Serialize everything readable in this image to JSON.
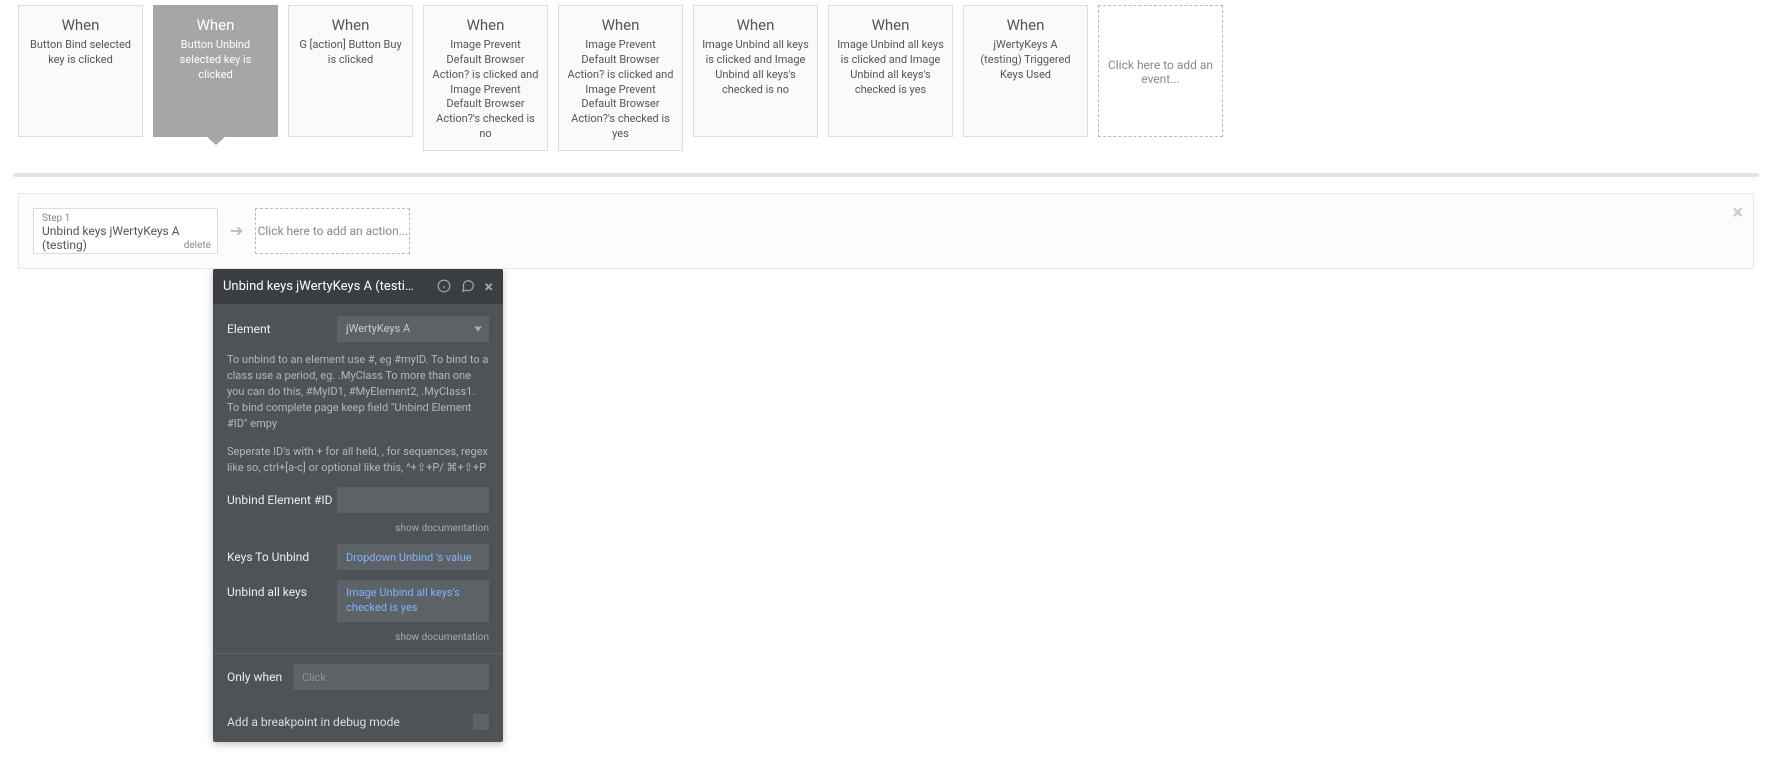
{
  "events": [
    {
      "title": "When",
      "body": "Button Bind selected key is clicked"
    },
    {
      "title": "When",
      "body": "Button Unbind selected key is clicked",
      "active": true
    },
    {
      "title": "When",
      "body": "G [action] Button Buy is clicked"
    },
    {
      "title": "When",
      "body": "Image Prevent Default Browser Action? is clicked and Image Prevent Default Browser Action?'s checked is no"
    },
    {
      "title": "When",
      "body": "Image Prevent Default Browser Action? is clicked and Image Prevent Default Browser Action?'s checked is yes"
    },
    {
      "title": "When",
      "body": "Image Unbind all keys is clicked and Image Unbind all keys's checked is no"
    },
    {
      "title": "When",
      "body": "Image Unbind all keys is clicked and Image Unbind all keys's checked is yes"
    },
    {
      "title": "When",
      "body": "jWertyKeys A (testing) Triggered Keys Used"
    }
  ],
  "add_event_label": "Click here to add an event...",
  "step": {
    "label": "Step 1",
    "title": "Unbind keys jWertyKeys A (testing)",
    "delete": "delete"
  },
  "add_step_label": "Click here to add an action...",
  "panel": {
    "header": "Unbind keys jWertyKeys A (testing)",
    "element_label": "Element",
    "element_value": "jWertyKeys A",
    "note1": "To unbind to an element use #, eg #myID. To bind to a class use a period, eg. .MyClass To more than one you can do this, #MyID1, #MyElement2, .MyClass1. To bind complete page keep field \"Unbind Element #ID\" empy",
    "note2": "Seperate ID's with + for all held, , for sequences, regex like so, ctrl+[a-c] or optional like this, ^+⇧+P/ ⌘+⇧+P",
    "unbind_el_label": "Unbind Element #ID",
    "keys_label": "Keys To Unbind",
    "keys_value": "Dropdown Unbind 's value",
    "unbind_all_label": "Unbind all keys",
    "unbind_all_value": "Image Unbind all keys's checked is yes",
    "show_doc": "show documentation",
    "only_when_label": "Only when",
    "only_when_placeholder": "Click",
    "breakpoint_label": "Add a breakpoint in debug mode"
  }
}
